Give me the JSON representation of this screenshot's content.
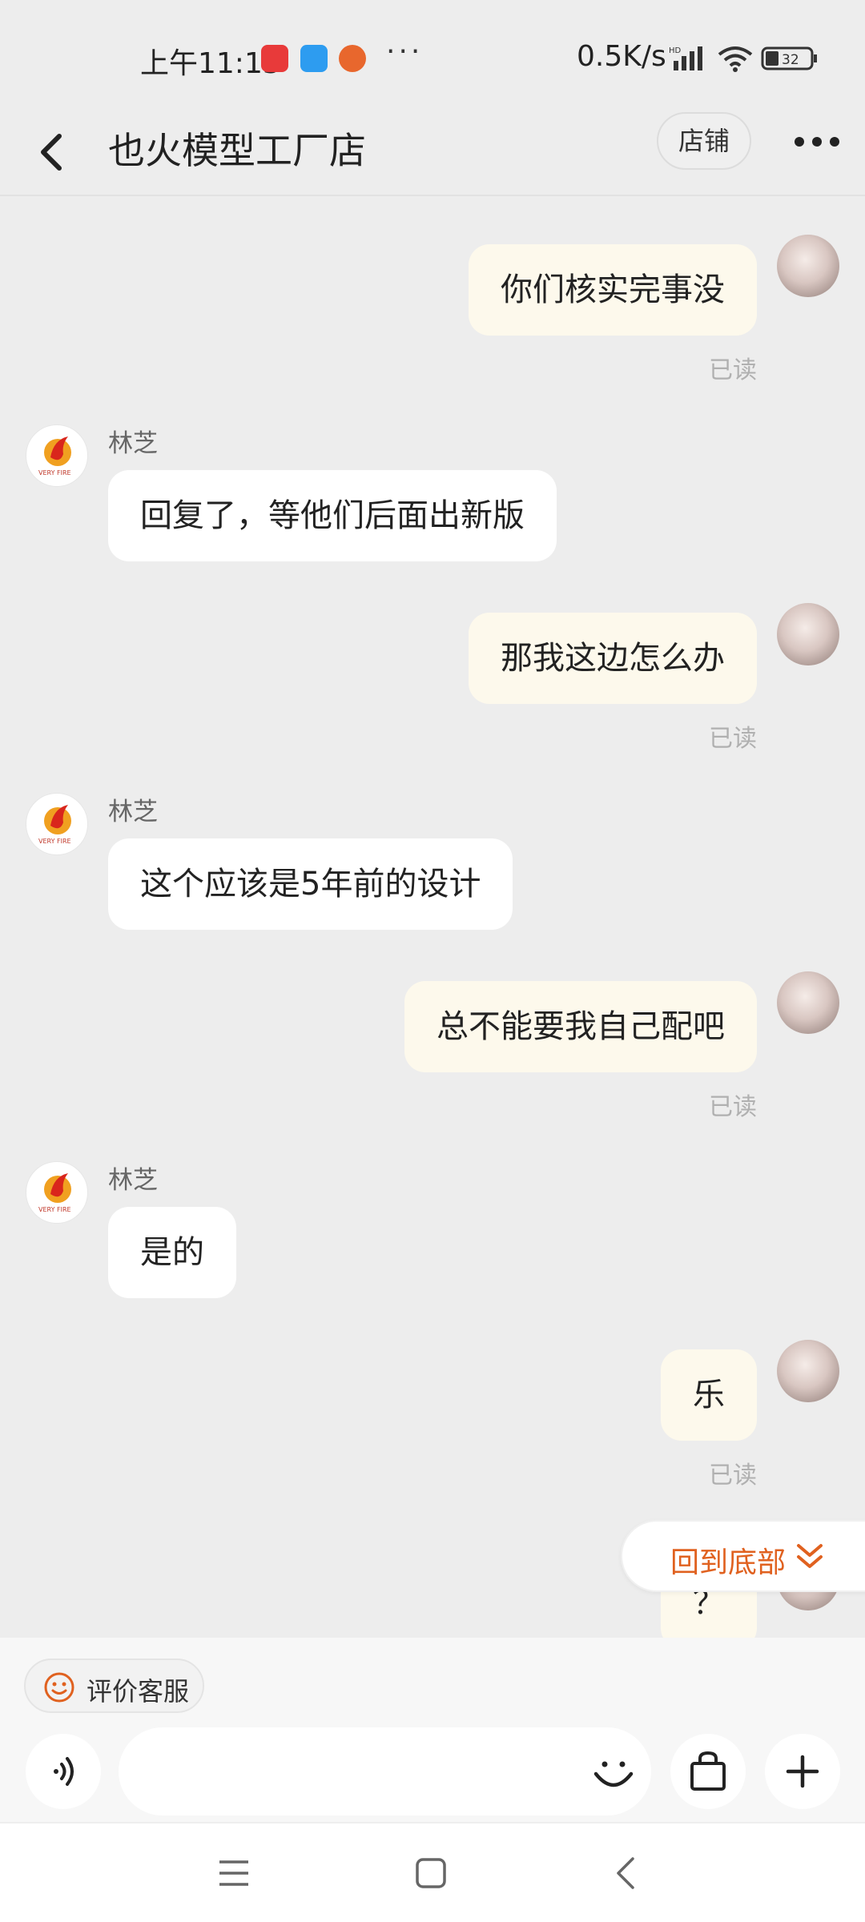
{
  "status_bar": {
    "time": "上午11:13",
    "more": "···",
    "network_speed": "0.5K/s",
    "battery": "32"
  },
  "header": {
    "title": "也火模型工厂店",
    "shop_button": "店铺"
  },
  "messages": [
    {
      "from": "me",
      "text": "你们核实完事没",
      "status": "已读"
    },
    {
      "from": "them",
      "sender": "林芝",
      "text": "回复了，等他们后面出新版"
    },
    {
      "from": "me",
      "text": "那我这边怎么办",
      "status": "已读"
    },
    {
      "from": "them",
      "sender": "林芝",
      "text": "这个应该是5年前的设计"
    },
    {
      "from": "me",
      "text": "总不能要我自己配吧",
      "status": "已读"
    },
    {
      "from": "them",
      "sender": "林芝",
      "text": "是的"
    },
    {
      "from": "me",
      "text": "乐",
      "status": "已读"
    },
    {
      "from": "me",
      "text": "？"
    }
  ],
  "back_to_bottom": "回到底部",
  "rate_service": "评价客服",
  "input": {
    "placeholder": ""
  },
  "colors": {
    "accent": "#e0611f",
    "my_bubble": "#fdf9ec",
    "their_bubble": "#ffffff",
    "background": "#ededed"
  },
  "icons": {
    "back": "chevron-left-icon",
    "more": "more-dots-icon",
    "voice": "voice-icon",
    "emoji": "smile-icon",
    "goods": "shopping-bag-icon",
    "plus": "plus-icon"
  }
}
